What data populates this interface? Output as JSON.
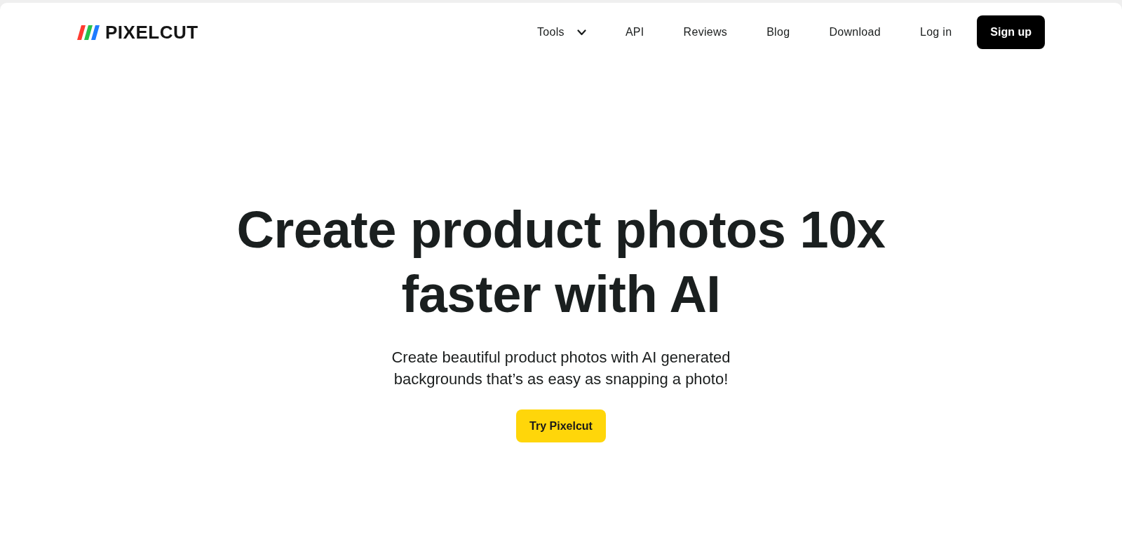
{
  "logo": {
    "text": "PIXELCUT"
  },
  "nav": {
    "items": [
      {
        "label": "Tools",
        "kind": "dropdown"
      },
      {
        "label": "API",
        "kind": "link"
      },
      {
        "label": "Reviews",
        "kind": "link"
      },
      {
        "label": "Blog",
        "kind": "link"
      },
      {
        "label": "Download",
        "kind": "link"
      },
      {
        "label": "Log in",
        "kind": "link"
      }
    ],
    "signup": "Sign up"
  },
  "hero": {
    "title": "Create product photos 10x faster with AI",
    "subtitle": "Create beautiful product photos with AI generated backgrounds that’s as easy as snapping a photo!",
    "cta": "Try Pixelcut"
  }
}
